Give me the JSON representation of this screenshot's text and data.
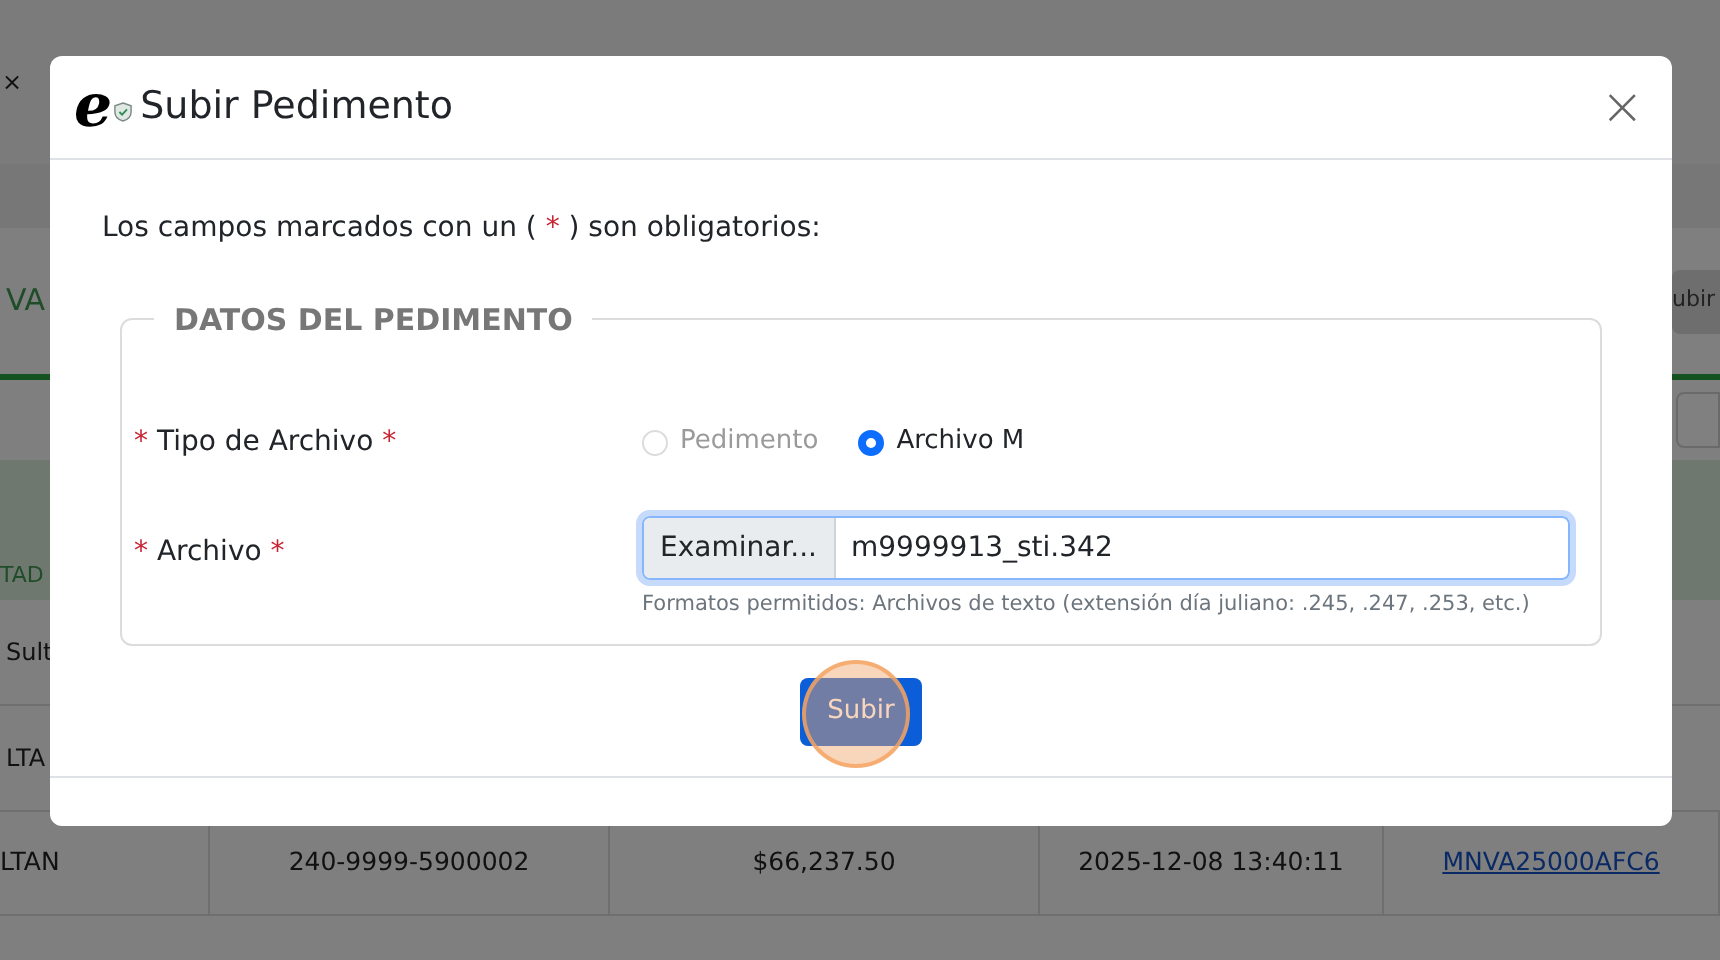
{
  "background": {
    "close_glyph": "×",
    "heading_fragment": "VA",
    "button_fragment": "ubir",
    "column_fragment": "TAD",
    "row_fragments": [
      "Sult",
      "LTA"
    ],
    "row": [
      "LTAN",
      "240-9999-5900002",
      "$66,237.50",
      "2025-12-08 13:40:11",
      "MNVA25000AFC6"
    ]
  },
  "modal": {
    "logo_text": "e",
    "title": "Subir Pedimento",
    "close_glyph": "×",
    "intro": {
      "before": "Los campos marcados con un (",
      "mark": "*",
      "after": ") son obligatorios:"
    },
    "fieldset": {
      "legend": "DATOS DEL PEDIMENTO",
      "fields": [
        {
          "kind": "radio",
          "mark_before": "*",
          "label": "Tipo de Archivo",
          "mark_after": "*",
          "options": [
            {
              "label": "Pedimento",
              "selected": false,
              "disabled": true
            },
            {
              "label": "Archivo M",
              "selected": true,
              "disabled": false
            }
          ]
        },
        {
          "kind": "file",
          "mark_before": "*",
          "label": "Archivo",
          "mark_after": "*",
          "button": "Examinar...",
          "value": "m9999913_sti.342",
          "hint": "Formatos permitidos: Archivos de texto (extensión día juliano: .245, .247, .253, etc.)"
        }
      ]
    },
    "submit": {
      "label": "Subir",
      "clicked": true
    }
  }
}
